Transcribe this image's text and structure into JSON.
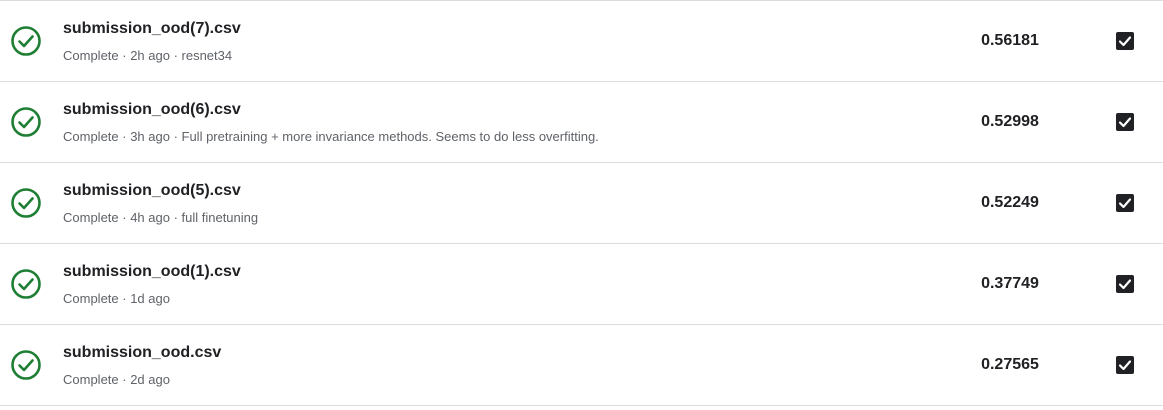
{
  "submissions": [
    {
      "filename": "submission_ood(7).csv",
      "meta": "Complete · 2h ago · resnet34",
      "score": "0.56181",
      "selected": true
    },
    {
      "filename": "submission_ood(6).csv",
      "meta": "Complete · 3h ago · Full pretraining + more invariance methods. Seems to do less overfitting.",
      "score": "0.52998",
      "selected": true
    },
    {
      "filename": "submission_ood(5).csv",
      "meta": "Complete · 4h ago · full finetuning",
      "score": "0.52249",
      "selected": true
    },
    {
      "filename": "submission_ood(1).csv",
      "meta": "Complete · 1d ago",
      "score": "0.37749",
      "selected": true
    },
    {
      "filename": "submission_ood.csv",
      "meta": "Complete · 2d ago",
      "score": "0.27565",
      "selected": true
    }
  ],
  "icons": {
    "status": "check-circle-icon",
    "select": "checkbox-checked-icon"
  },
  "colors": {
    "success": "#1e7e34",
    "checkbox": "#202124"
  }
}
